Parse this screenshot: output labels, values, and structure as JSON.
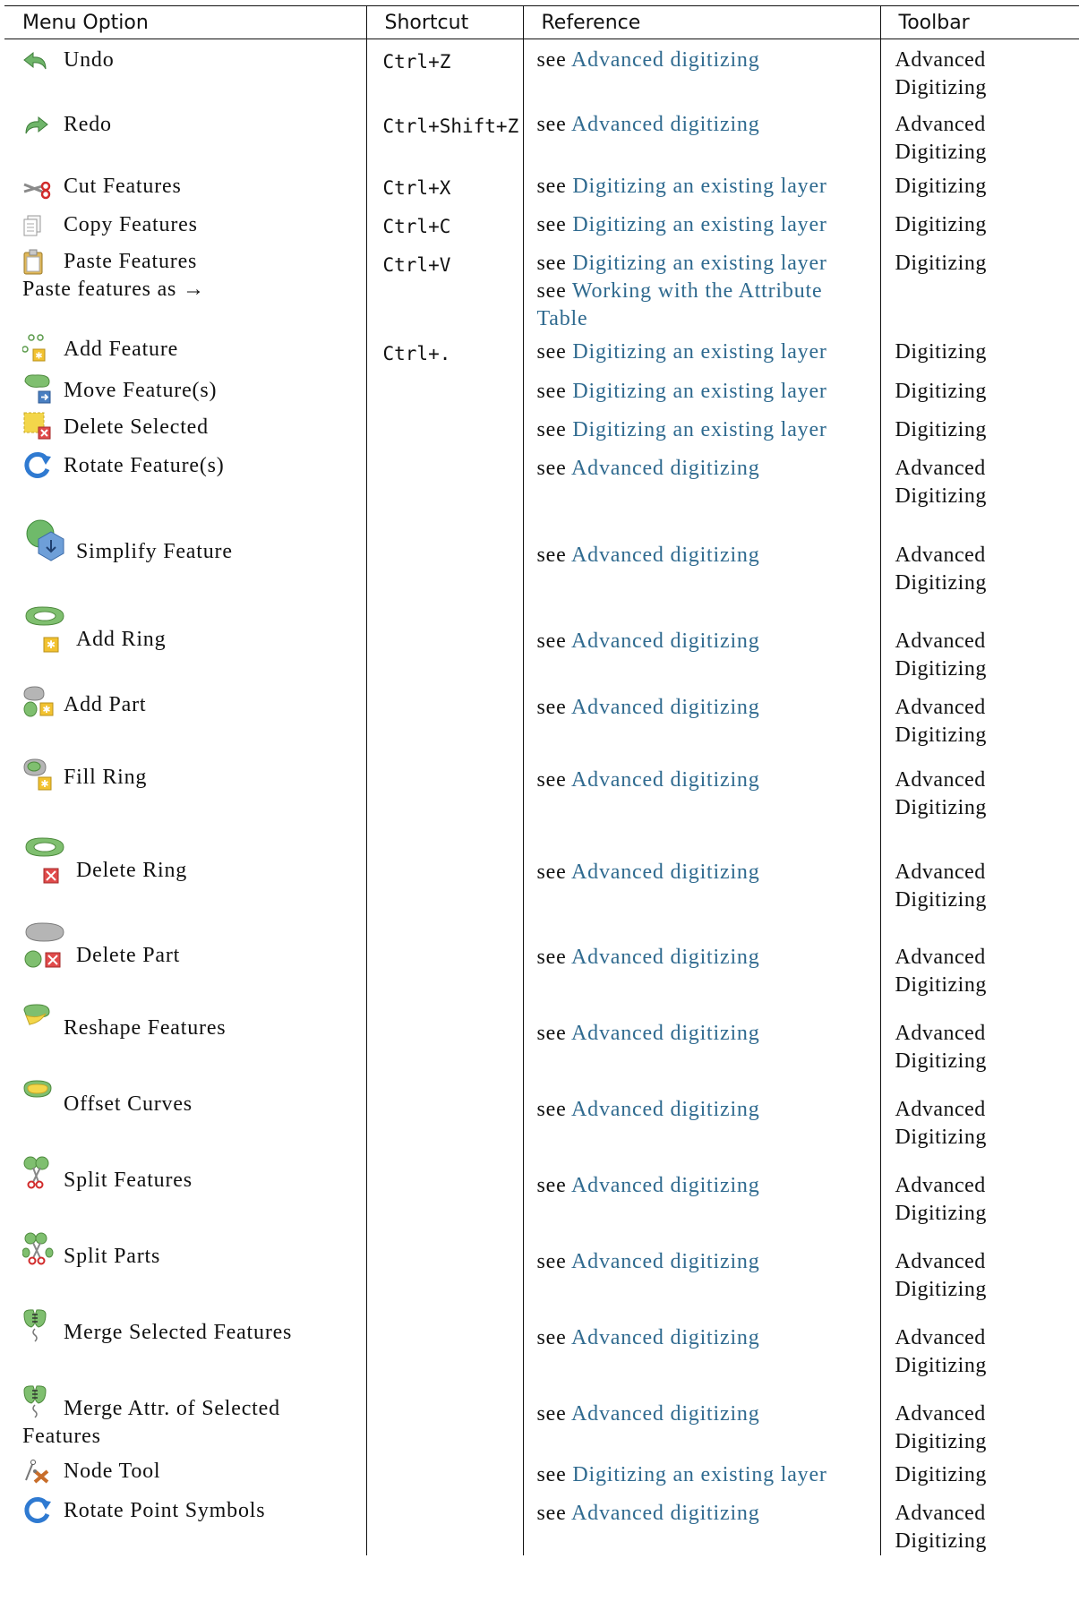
{
  "columns": [
    "Menu Option",
    "Shortcut",
    "Reference",
    "Toolbar"
  ],
  "rows": [
    {
      "icon": "undo-icon",
      "label": "Undo",
      "shortcut": "Ctrl+Z",
      "ref_prefix": "see",
      "ref_link": "Advanced digitizing",
      "toolbar": "Advanced Digitizing"
    },
    {
      "icon": "redo-icon",
      "label": "Redo",
      "shortcut": "Ctrl+Shift+Z",
      "ref_prefix": "see",
      "ref_link": "Advanced digitizing",
      "toolbar": "Advanced Digitizing"
    },
    {
      "icon": "cut-icon",
      "label": "Cut Features",
      "shortcut": "Ctrl+X",
      "ref_prefix": "see",
      "ref_link": "Digitizing an existing layer",
      "toolbar": "Digitizing"
    },
    {
      "icon": "copy-icon",
      "label": "Copy Features",
      "shortcut": "Ctrl+C",
      "ref_prefix": "see",
      "ref_link": "Digitizing an existing layer",
      "toolbar": "Digitizing"
    },
    {
      "icon": "paste-icon",
      "label": "Paste Features",
      "sub_label": "Paste features as →",
      "shortcut": "Ctrl+V",
      "ref_prefix": "see",
      "ref_link": "Digitizing an existing layer",
      "ref_prefix2": "see",
      "ref_link2": "Working with the Attribute Table",
      "toolbar": "Digitizing"
    },
    {
      "icon": "add-feature-icon",
      "label": "Add Feature",
      "shortcut": "Ctrl+.",
      "ref_prefix": "see",
      "ref_link": "Digitizing an existing layer",
      "toolbar": "Digitizing"
    },
    {
      "icon": "move-feature-icon",
      "label": "Move Feature(s)",
      "shortcut": "",
      "ref_prefix": "see",
      "ref_link": "Digitizing an existing layer",
      "toolbar": "Digitizing"
    },
    {
      "icon": "delete-selected-icon",
      "label": "Delete Selected",
      "shortcut": "",
      "ref_prefix": "see",
      "ref_link": "Digitizing an existing layer",
      "toolbar": "Digitizing"
    },
    {
      "icon": "rotate-feature-icon",
      "label": "Rotate Feature(s)",
      "shortcut": "",
      "ref_prefix": "see",
      "ref_link": "Advanced digitizing",
      "toolbar": "Advanced Digitizing"
    },
    {
      "icon": "simplify-feature-icon",
      "label": "Simplify Feature",
      "shortcut": "",
      "ref_prefix": "see",
      "ref_link": "Advanced digitizing",
      "toolbar": "Advanced Digitizing"
    },
    {
      "icon": "add-ring-icon",
      "label": "Add Ring",
      "shortcut": "",
      "ref_prefix": "see",
      "ref_link": "Advanced digitizing",
      "toolbar": "Advanced Digitizing"
    },
    {
      "icon": "add-part-icon",
      "label": "Add Part",
      "shortcut": "",
      "ref_prefix": "see",
      "ref_link": "Advanced digitizing",
      "toolbar": "Advanced Digitizing"
    },
    {
      "icon": "fill-ring-icon",
      "label": "Fill Ring",
      "shortcut": "",
      "ref_prefix": "see",
      "ref_link": "Advanced digitizing",
      "toolbar": "Advanced Digitizing"
    },
    {
      "icon": "delete-ring-icon",
      "label": "Delete Ring",
      "shortcut": "",
      "ref_prefix": "see",
      "ref_link": "Advanced digitizing",
      "toolbar": "Advanced Digitizing"
    },
    {
      "icon": "delete-part-icon",
      "label": "Delete Part",
      "shortcut": "",
      "ref_prefix": "see",
      "ref_link": "Advanced digitizing",
      "toolbar": "Advanced Digitizing"
    },
    {
      "icon": "reshape-features-icon",
      "label": "Reshape Features",
      "shortcut": "",
      "ref_prefix": "see",
      "ref_link": "Advanced digitizing",
      "toolbar": "Advanced Digitizing"
    },
    {
      "icon": "offset-curves-icon",
      "label": "Offset Curves",
      "shortcut": "",
      "ref_prefix": "see",
      "ref_link": "Advanced digitizing",
      "toolbar": "Advanced Digitizing"
    },
    {
      "icon": "split-features-icon",
      "label": "Split Features",
      "shortcut": "",
      "ref_prefix": "see",
      "ref_link": "Advanced digitizing",
      "toolbar": "Advanced Digitizing"
    },
    {
      "icon": "split-parts-icon",
      "label": "Split Parts",
      "shortcut": "",
      "ref_prefix": "see",
      "ref_link": "Advanced digitizing",
      "toolbar": "Advanced Digitizing"
    },
    {
      "icon": "merge-features-icon",
      "label": "Merge Selected Features",
      "shortcut": "",
      "ref_prefix": "see",
      "ref_link": "Advanced digitizing",
      "toolbar": "Advanced Digitizing"
    },
    {
      "icon": "merge-attributes-icon",
      "label": "Merge Attr. of Selected",
      "label_cont": "Features",
      "shortcut": "",
      "ref_prefix": "see",
      "ref_link": "Advanced digitizing",
      "toolbar": "Advanced Digitizing"
    },
    {
      "icon": "node-tool-icon",
      "label": "Node Tool",
      "shortcut": "",
      "ref_prefix": "see",
      "ref_link": "Digitizing an existing layer",
      "toolbar": "Digitizing"
    },
    {
      "icon": "rotate-point-symbols-icon",
      "label": "Rotate Point Symbols",
      "shortcut": "",
      "ref_prefix": "see",
      "ref_link": "Advanced digitizing",
      "toolbar": "Advanced Digitizing"
    }
  ]
}
